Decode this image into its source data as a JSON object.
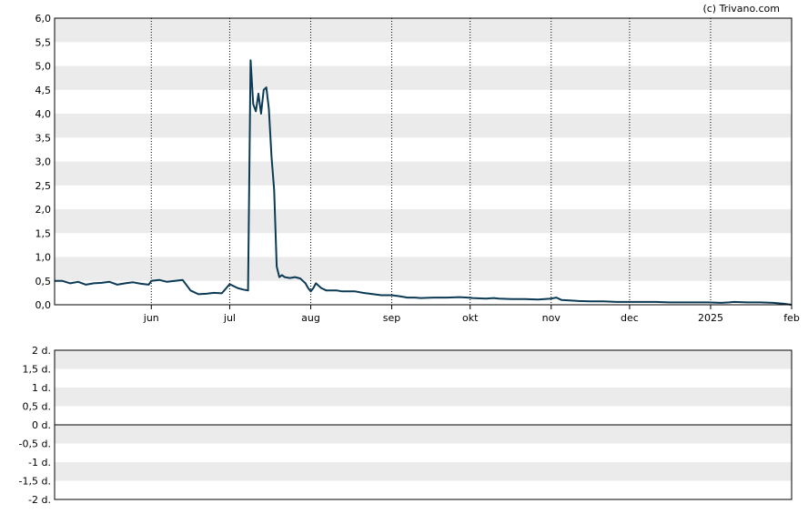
{
  "credit": "(c) Trivano.com",
  "colors": {
    "line": "#0b3a55",
    "band": "#ebebeb",
    "axis": "#000000",
    "zero_line": "#000000"
  },
  "chart_data": [
    {
      "type": "line",
      "title": "",
      "xlabel": "",
      "ylabel": "",
      "ylim": [
        0,
        6
      ],
      "grid": "horizontal alternating bands, dotted vertical month lines",
      "y_ticks": [
        "0,0",
        "0,5",
        "1,0",
        "1,5",
        "2,0",
        "2,5",
        "3,0",
        "3,5",
        "4,0",
        "4,5",
        "5,0",
        "5,5",
        "6,0"
      ],
      "x_ticks": [
        {
          "label": "jun",
          "day": 37
        },
        {
          "label": "jul",
          "day": 67
        },
        {
          "label": "aug",
          "day": 98
        },
        {
          "label": "sep",
          "day": 129
        },
        {
          "label": "okt",
          "day": 159
        },
        {
          "label": "nov",
          "day": 190
        },
        {
          "label": "dec",
          "day": 220
        },
        {
          "label": "2025",
          "day": 251
        },
        {
          "label": "feb",
          "day": 282
        }
      ],
      "x_range": [
        0,
        282
      ],
      "series": [
        {
          "x": [
            0,
            3,
            6,
            9,
            12,
            15,
            18,
            21,
            24,
            27,
            30,
            33,
            36,
            37,
            40,
            43,
            46,
            49,
            52,
            55,
            58,
            61,
            64,
            67,
            70,
            72,
            74,
            75,
            76,
            77,
            78,
            79,
            80,
            81,
            82,
            83,
            84,
            85,
            86,
            87,
            88,
            90,
            92,
            94,
            95,
            96,
            97,
            98,
            99,
            100,
            102,
            104,
            106,
            108,
            110,
            115,
            118,
            122,
            125,
            129,
            132,
            135,
            138,
            140,
            145,
            150,
            155,
            158,
            160,
            165,
            168,
            170,
            175,
            180,
            185,
            190,
            192,
            194,
            197,
            200,
            205,
            210,
            215,
            220,
            225,
            230,
            235,
            240,
            245,
            250,
            255,
            258,
            260,
            265,
            270,
            275,
            279,
            282
          ],
          "y": [
            0.5,
            0.5,
            0.45,
            0.48,
            0.42,
            0.45,
            0.46,
            0.48,
            0.42,
            0.45,
            0.47,
            0.44,
            0.42,
            0.5,
            0.52,
            0.48,
            0.5,
            0.52,
            0.3,
            0.22,
            0.23,
            0.25,
            0.24,
            0.43,
            0.35,
            0.32,
            0.3,
            5.12,
            4.2,
            4.05,
            4.42,
            4.0,
            4.5,
            4.55,
            4.1,
            3.1,
            2.4,
            0.8,
            0.58,
            0.62,
            0.58,
            0.56,
            0.58,
            0.55,
            0.5,
            0.45,
            0.35,
            0.28,
            0.35,
            0.45,
            0.35,
            0.3,
            0.3,
            0.3,
            0.28,
            0.28,
            0.25,
            0.22,
            0.2,
            0.2,
            0.18,
            0.15,
            0.15,
            0.14,
            0.15,
            0.15,
            0.16,
            0.15,
            0.14,
            0.13,
            0.14,
            0.13,
            0.12,
            0.12,
            0.11,
            0.13,
            0.15,
            0.1,
            0.09,
            0.08,
            0.07,
            0.07,
            0.06,
            0.06,
            0.06,
            0.06,
            0.05,
            0.05,
            0.05,
            0.05,
            0.04,
            0.05,
            0.06,
            0.05,
            0.05,
            0.04,
            0.02,
            0.0
          ]
        }
      ]
    },
    {
      "type": "bar",
      "title": "",
      "xlabel": "",
      "ylabel": "",
      "ylim": [
        -2,
        2
      ],
      "y_ticks": [
        "2 d.",
        "1,5 d.",
        "1 d.",
        "0,5 d.",
        "0 d.",
        "-0,5 d.",
        "-1 d.",
        "-1,5 d.",
        "-2 d."
      ],
      "series": []
    }
  ]
}
